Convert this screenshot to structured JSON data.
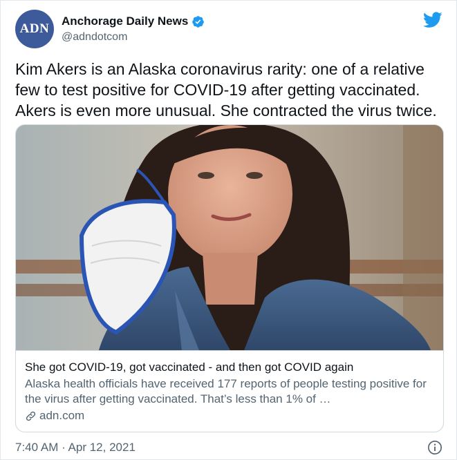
{
  "account": {
    "avatar_text": "ADN",
    "display_name": "Anchorage Daily News",
    "handle": "@adndotcom",
    "verified": true,
    "avatar_color": "#3d5a9a"
  },
  "brand": {
    "logo": "twitter-bird-icon",
    "color": "#1d9bf0"
  },
  "tweet": {
    "text": "Kim Akers is an Alaska coronavirus rarity: one of a relative few to test positive for COVID-19 after getting vaccinated. Akers is even more unusual. She contracted the virus twice.",
    "timestamp": "7:40 AM · Apr 12, 2021"
  },
  "card": {
    "title": "She got COVID-19, got vaccinated - and then got COVID again",
    "description": "Alaska health officials have received 177 reports of people testing positive for the virus after getting vaccinated. That’s less than 1% of …",
    "domain": "adn.com",
    "image": "photo-woman-holding-mask"
  },
  "icons": {
    "verified": "verified-badge-icon",
    "link": "link-icon",
    "info": "info-icon"
  }
}
